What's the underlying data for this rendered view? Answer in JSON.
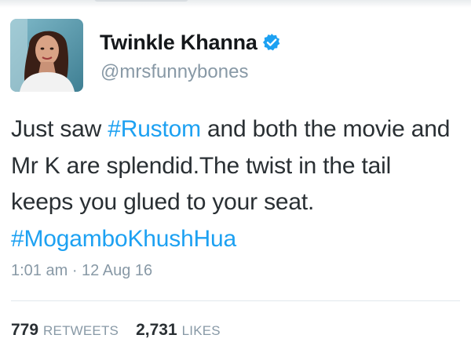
{
  "tweet": {
    "author": {
      "display_name": "Twinkle Khanna",
      "handle": "@mrsfunnybones",
      "verified": true
    },
    "text": {
      "part1": "Just saw ",
      "hashtag1": "#Rustom",
      "part2": " and both the movie and Mr K are splendid.The twist in the tail keeps you glued to your seat. ",
      "hashtag2": "#MogamboKhushHua"
    },
    "timestamp": "1:01 am · 12 Aug 16",
    "stats": {
      "retweets_count": "779",
      "retweets_label": "RETWEETS",
      "likes_count": "2,731",
      "likes_label": "LIKES"
    }
  },
  "colors": {
    "hashtag": "#1da1f2",
    "secondary_text": "#8899a6",
    "verified_badge": "#1da1f2"
  }
}
